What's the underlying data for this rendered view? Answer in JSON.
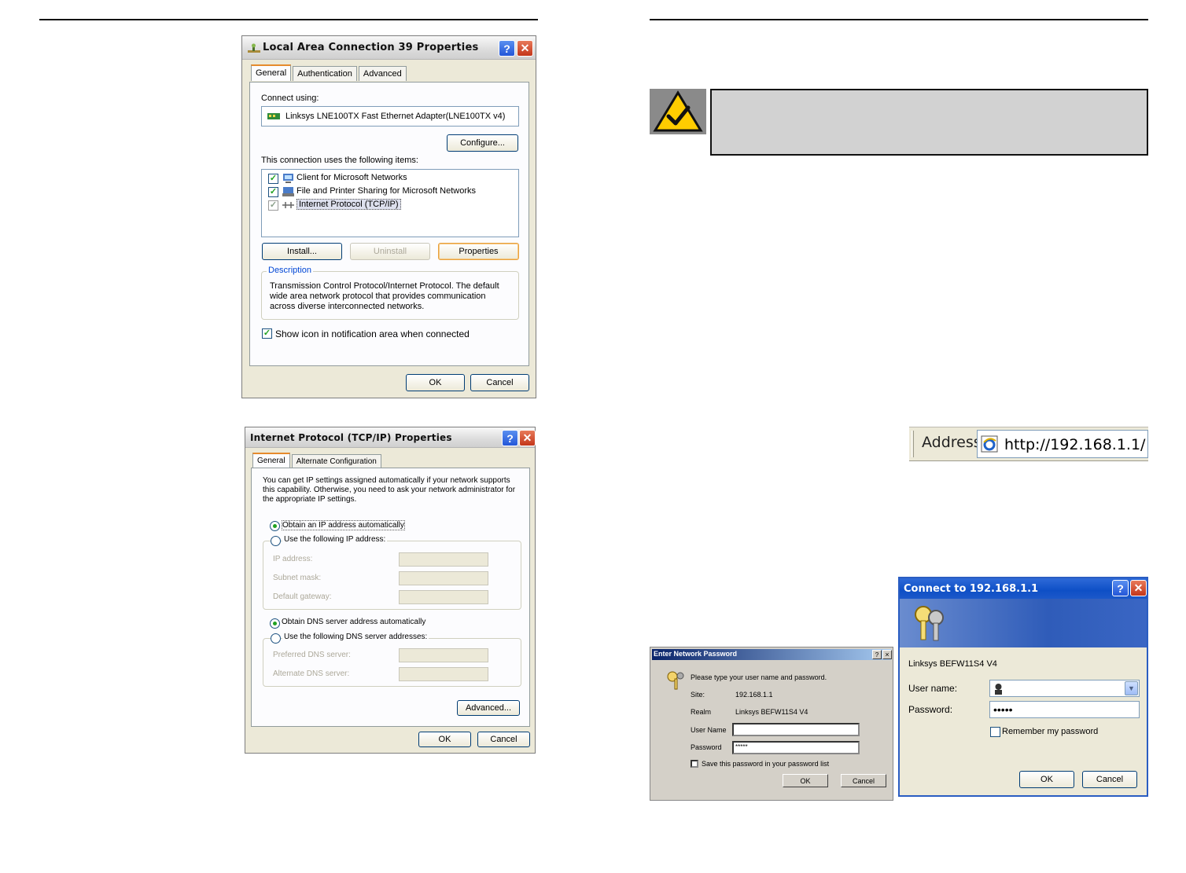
{
  "lan_dialog": {
    "title": "Local Area Connection 39 Properties",
    "tabs": [
      "General",
      "Authentication",
      "Advanced"
    ],
    "connect_using_label": "Connect using:",
    "adapter": "Linksys LNE100TX Fast Ethernet Adapter(LNE100TX v4)",
    "configure_btn": "Configure...",
    "items_label": "This connection uses the following items:",
    "items": [
      "Client for Microsoft Networks",
      "File and Printer Sharing for Microsoft Networks",
      "Internet Protocol (TCP/IP)"
    ],
    "install_btn": "Install...",
    "uninstall_btn": "Uninstall",
    "properties_btn": "Properties",
    "description_legend": "Description",
    "description_text": "Transmission Control Protocol/Internet Protocol. The default wide area network protocol that provides communication across diverse interconnected networks.",
    "show_icon_label": "Show icon in notification area when connected",
    "ok_btn": "OK",
    "cancel_btn": "Cancel"
  },
  "tcpip_dialog": {
    "title": "Internet Protocol (TCP/IP) Properties",
    "tabs": [
      "General",
      "Alternate Configuration"
    ],
    "intro": "You can get IP settings assigned automatically if your network supports this capability. Otherwise, you need to ask your network administrator for the appropriate IP settings.",
    "obtain_ip": "Obtain an IP address automatically",
    "use_ip": "Use the following IP address:",
    "ip_address": "IP address:",
    "subnet_mask": "Subnet mask:",
    "default_gateway": "Default gateway:",
    "obtain_dns": "Obtain DNS server address automatically",
    "use_dns": "Use the following DNS server addresses:",
    "preferred_dns": "Preferred DNS server:",
    "alternate_dns": "Alternate DNS server:",
    "advanced_btn": "Advanced...",
    "ok_btn": "OK",
    "cancel_btn": "Cancel"
  },
  "address_bar": {
    "label": "Address",
    "url": "http://192.168.1.1/"
  },
  "enter_password_dialog": {
    "title": "Enter Network Password",
    "help": "?",
    "close": "×",
    "prompt": "Please type your user name and password.",
    "site_label": "Site:",
    "site_value": "192.168.1.1",
    "realm_label": "Realm",
    "realm_value": "Linksys BEFW11S4 V4",
    "user_label": "User Name",
    "password_label": "Password",
    "password_value": "*****",
    "save_label": "Save this password in your password list",
    "ok_btn": "OK",
    "cancel_btn": "Cancel"
  },
  "connect_dialog": {
    "title": "Connect to 192.168.1.1",
    "realm": "Linksys BEFW11S4 V4",
    "user_label": "User name:",
    "password_label": "Password:",
    "password_value": "•••••",
    "remember_label": "Remember my password",
    "ok_btn": "OK",
    "cancel_btn": "Cancel"
  }
}
